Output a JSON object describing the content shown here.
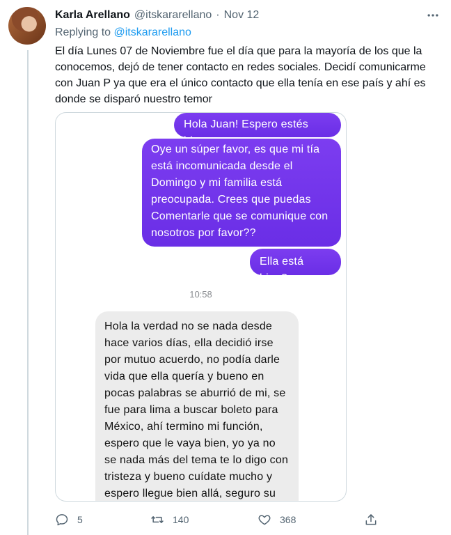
{
  "tweet": {
    "author_name": "Karla Arellano",
    "author_handle": "@itskararellano",
    "separator": "·",
    "date": "Nov 12",
    "replying_prefix": "Replying to",
    "replying_to": "@itskararellano",
    "text": "El día Lunes 07 de Noviembre fue el día que para la mayoría de los que la conocemos, dejó de tener contacto en redes sociales. Decidí comunicarme con Juan P ya que era el único contacto que ella tenía en ese país y ahí es donde se disparó nuestro temor"
  },
  "chat": {
    "messages": [
      {
        "direction": "outgoing",
        "text": "Hola Juan! Espero estés bien"
      },
      {
        "direction": "outgoing",
        "text": "Oye un súper favor, es que mi tía está incomunicada desde el Domingo y mi familia está preocupada. Crees que puedas Comentarle que se comunique con nosotros por favor??"
      },
      {
        "direction": "outgoing",
        "text": "Ella está bien?"
      },
      {
        "direction": "incoming",
        "text": "Hola la verdad no se nada desde hace varios días, ella decidió irse por mutuo acuerdo, no podía darle vida que ella quería y bueno en pocas palabras se aburrió de mi, se fue para lima a buscar boleto para México, ahí termino mi función, espero que le vaya bien, yo ya no se nada más del tema te lo digo con tristeza y bueno cuídate mucho y espero llegue bien allá, seguro su"
      }
    ],
    "timestamp": "10:58"
  },
  "actions": {
    "reply_count": "5",
    "retweet_count": "140",
    "like_count": "368"
  },
  "icons": {
    "more": "more-horizontal-icon",
    "reply": "reply-icon",
    "retweet": "retweet-icon",
    "like": "heart-icon",
    "share": "share-icon"
  },
  "colors": {
    "link": "#1d9bf0",
    "secondary_text": "#536471",
    "outgoing_bubble": "#7c3df0",
    "incoming_bubble": "#ececec"
  }
}
